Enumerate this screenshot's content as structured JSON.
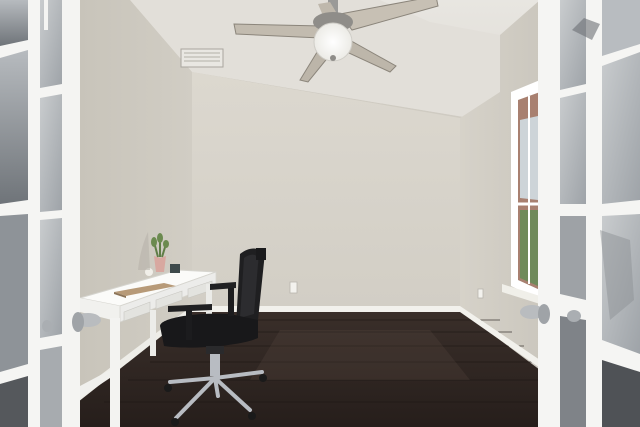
{
  "scene": {
    "kind": "home-office-photo",
    "colors": {
      "ceiling": "#e4e1da",
      "back_wall": "#d8d4cb",
      "left_wall": "#cdc9bf",
      "right_wall": "#d3cfc6",
      "floor": "#2e2521",
      "floor_highlight": "#4a3d36",
      "baseboard": "#f2f1ec",
      "door_frame": "#f4f4f2",
      "desk": "#f6f6f4",
      "chair": "#1c1c1e",
      "chrome": "#b8bcc2"
    },
    "objects": [
      "ceiling-fan",
      "air-vent",
      "window",
      "french-door-left",
      "french-door-right",
      "white-desk",
      "office-chair",
      "potted-plant",
      "book",
      "wall-outlet"
    ]
  }
}
